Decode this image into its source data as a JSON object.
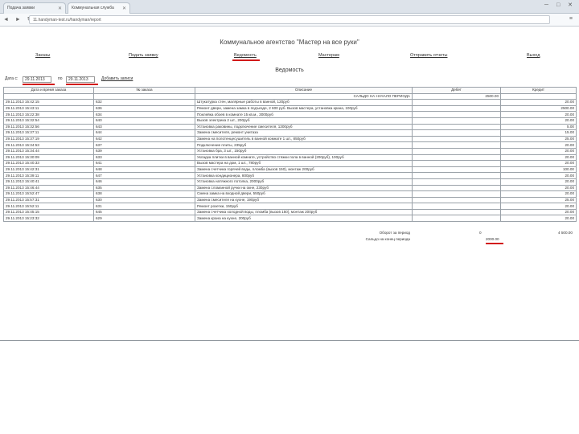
{
  "browser": {
    "tabs": [
      {
        "label": "Подача заявки"
      },
      {
        "label": "Коммунальная служба"
      }
    ],
    "url": "11.handyman-test.ru/handyman/report",
    "window_buttons": "─ □ ✕",
    "nav_icons": "◄ ► ↻",
    "menu_icon": "≡"
  },
  "site": {
    "title": "Коммунальное агентство \"Мастер на все руки\"",
    "nav": [
      {
        "label": "Заказы"
      },
      {
        "label": "Подать заявку"
      },
      {
        "label": "Ведомость"
      },
      {
        "label": "Мастерам"
      },
      {
        "label": "Отправить отчеты"
      },
      {
        "label": "Выход"
      }
    ]
  },
  "report": {
    "title": "Ведомость",
    "filter": {
      "from_label": "Дата с:",
      "from_value": "29.11.2013",
      "to_label": "по",
      "to_value": "29.11.2013",
      "apply_label": "Добавить записи"
    },
    "columns": [
      "Дата и время заказа",
      "№ заказа",
      "Описание",
      "Дебет",
      "Кредит"
    ],
    "opening": {
      "label": "САЛЬДО НА НАЧАЛО ПЕРИОДА",
      "debit": "2500.00"
    },
    "rows": [
      {
        "date": "29.11.2013 15:42:15",
        "num": "632",
        "desc": "Штукатурка стен, малярные работы в ванной, 120руб",
        "credit": "20.00"
      },
      {
        "date": "29.11.2013 15:43:11",
        "num": "636",
        "desc": "Ремонт двери, замена замка в подъезде, 2 600 руб. Вызов мастера, установка крана, 100руб",
        "credit": "2500.00"
      },
      {
        "date": "29.11.2013 15:22:38",
        "num": "634",
        "desc": "Поклейка обоев в комнате 15 кв.м., 3000руб",
        "credit": "20.00"
      },
      {
        "date": "29.11.2013 15:32:54",
        "num": "640",
        "desc": "Вызов электрика 2 шт., 200руб",
        "credit": "20.00"
      },
      {
        "date": "29.11.2013 15:32:56",
        "num": "643",
        "desc": "Установка раковины, подключение смесителя, 1300руб",
        "credit": "5.00"
      },
      {
        "date": "29.11.2013 15:37:11",
        "num": "644",
        "desc": "Замена смесителя, ремонт унитаза",
        "credit": "15.00"
      },
      {
        "date": "29.11.2013 15:37:19",
        "num": "642",
        "desc": "Замена на полотенцесушитель в ванной комнате 1 шт., 850руб",
        "credit": "25.00"
      },
      {
        "date": "29.11.2013 15:34:53",
        "num": "637",
        "desc": "Подключение плиты, 235руб",
        "credit": "20.00"
      },
      {
        "date": "29.11.2013 15:34:44",
        "num": "639",
        "desc": "Установка бра, 3 шт., 150руб",
        "credit": "20.00"
      },
      {
        "date": "29.11.2013 15:30:09",
        "num": "633",
        "desc": "Укладка плитки в ванной комнате, устройство стяжки пола в ванной (200руб), 100руб",
        "credit": "20.00"
      },
      {
        "date": "29.11.2013 15:40:33",
        "num": "641",
        "desc": "Вызов мастера на дом, 1 шт., 780руб",
        "credit": "20.00"
      },
      {
        "date": "29.11.2013 15:42:31",
        "num": "648",
        "desc": "Замена счетчика горячей воды, пломба (вызов 150), монтаж 200руб",
        "credit": "100.00"
      },
      {
        "date": "29.11.2013 15:39:11",
        "num": "647",
        "desc": "Установка кондиционера, 800руб",
        "credit": "20.00"
      },
      {
        "date": "29.11.2013 15:40:41",
        "num": "646",
        "desc": "Установка натяжного потолка, 2000руб",
        "credit": "20.00"
      },
      {
        "date": "29.11.2013 15:46:44",
        "num": "635",
        "desc": "Замена сломанной ручки на окне, 230руб",
        "credit": "20.00"
      },
      {
        "date": "29.11.2013 15:52:47",
        "num": "638",
        "desc": "Смена замка на входной двери, 550руб",
        "credit": "20.00"
      },
      {
        "date": "29.11.2013 15:57:31",
        "num": "630",
        "desc": "Замена смесителя на кухне, 190руб",
        "credit": "25.00"
      },
      {
        "date": "29.11.2013 15:52:11",
        "num": "631",
        "desc": "Ремонт розетки, 150руб",
        "credit": "20.00"
      },
      {
        "date": "29.11.2013 15:45:15",
        "num": "645",
        "desc": "Замена счетчика холодной воды, пломба (вызов 150), монтаж 200руб",
        "credit": "20.00"
      },
      {
        "date": "29.11.2013 15:23:32",
        "num": "629",
        "desc": "Замена крана на кухне, 200руб",
        "credit": "20.00"
      }
    ],
    "totals": [
      {
        "label": "Оборот за период",
        "debit": "0",
        "credit": "4 500.00"
      },
      {
        "label": "Сальдо на конец периода",
        "debit": "2000.00",
        "credit": ""
      }
    ]
  },
  "colors": {
    "accent_underline": "#d21a1a",
    "table_border": "#9aa1a8"
  }
}
